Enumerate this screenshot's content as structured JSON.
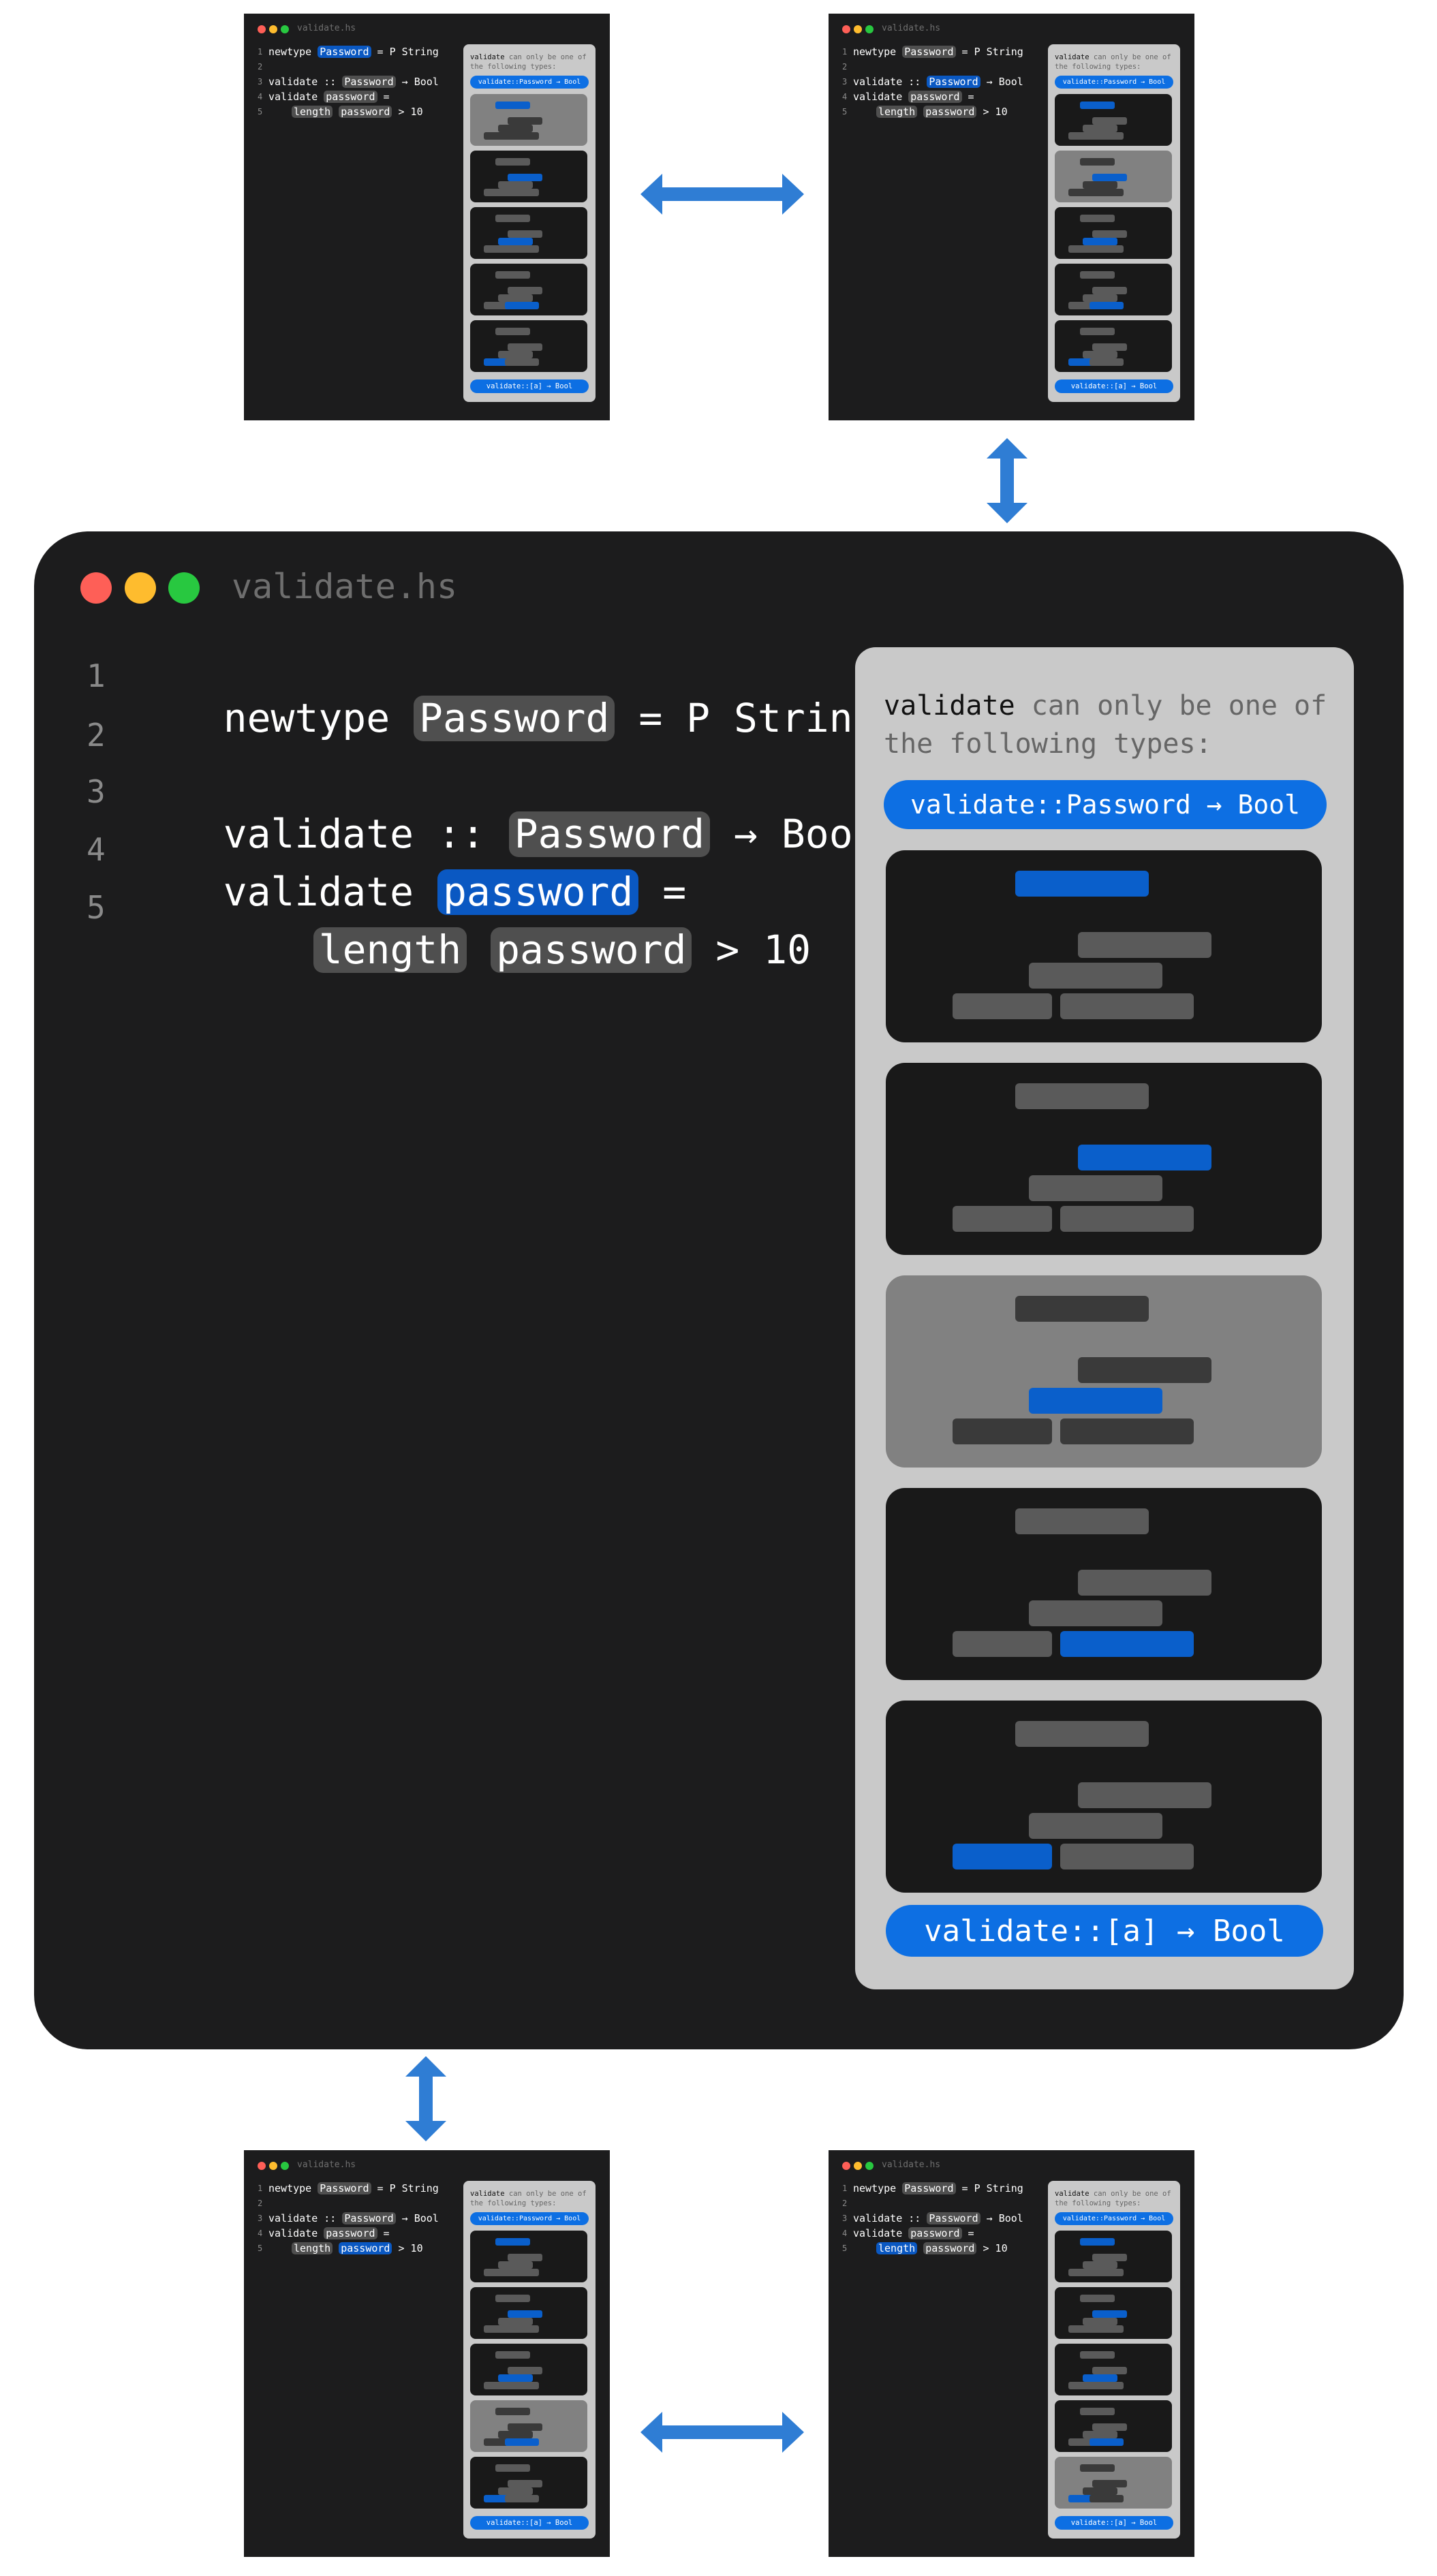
{
  "filename": "validate.hs",
  "window_dots": {
    "red": "#fe5f57",
    "yellow": "#febc2e",
    "green": "#28c840"
  },
  "line_numbers": [
    "1",
    "2",
    "3",
    "4",
    "5"
  ],
  "code": {
    "l1_kw": "newtype",
    "l1_type": "Password",
    "l1_rest": "= P String",
    "l3_fn": "validate",
    "l3_sep": "::",
    "l3_type": "Password",
    "l3_rest": "→ Bool",
    "l4_fn": "validate",
    "l4_arg": "password",
    "l4_eq": "=",
    "l5_fn": "length",
    "l5_arg": "password",
    "l5_rest": "> 10"
  },
  "panel": {
    "title_kw": "validate",
    "title_rest_1": " can only be one of",
    "title_rest_2": "the following types:",
    "top_option": "validate::Password → Bool",
    "bottom_option": "validate::[a] → Bool"
  },
  "colors": {
    "editor_bg": "#1c1c1d",
    "panel_bg": "#c9c9c9",
    "accent_blue": "#0d6fe3",
    "highlight_blue": "#0a58c2",
    "token_gray": "#4f4f4f",
    "arrow_blue": "#2f7dd4"
  },
  "main_state": {
    "selected_card": 3,
    "highlighted_token": "password (line 4)"
  },
  "thumbnails": [
    {
      "id": "top-left",
      "selected_card": 1,
      "highlighted_token": "Password (line 1)"
    },
    {
      "id": "top-right",
      "selected_card": 2,
      "highlighted_token": "Password (line 3)"
    },
    {
      "id": "bottom-left",
      "selected_card": 4,
      "highlighted_token": "password (line 5)"
    },
    {
      "id": "bottom-right",
      "selected_card": 5,
      "highlighted_token": "length (line 5)"
    }
  ]
}
